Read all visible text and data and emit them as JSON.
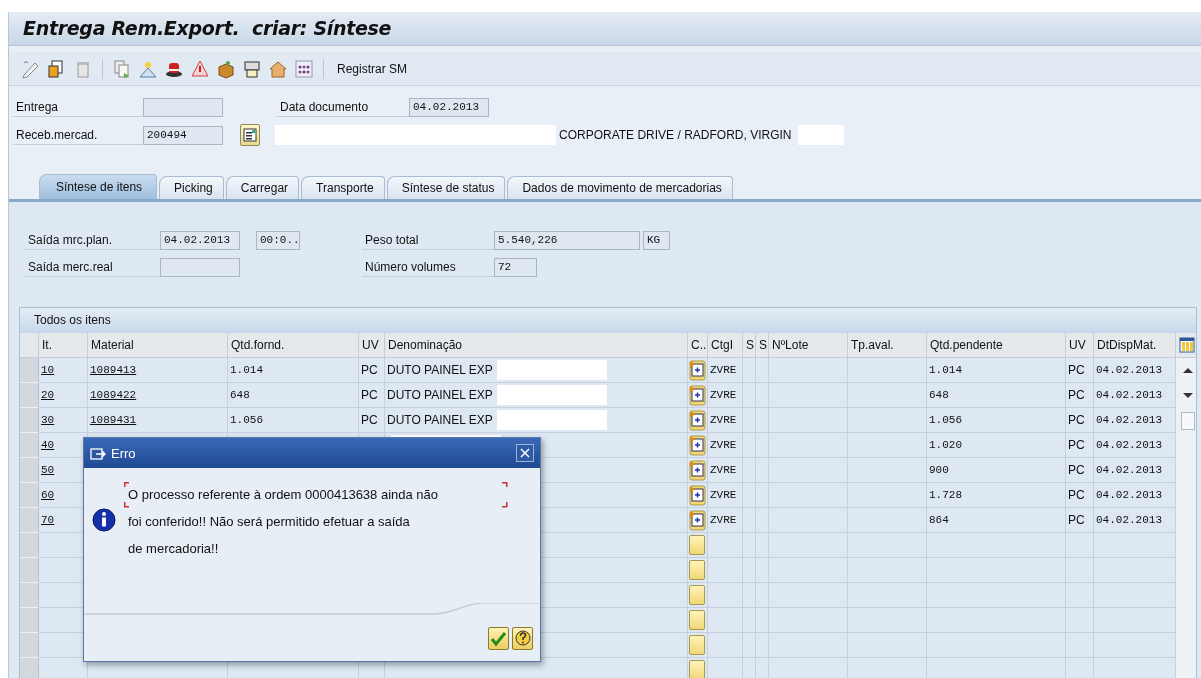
{
  "window": {
    "title": "Entrega Rem.Export.  criar: Síntese"
  },
  "toolbar": {
    "button_label": "Registrar SM"
  },
  "header": {
    "delivery": {
      "label": "Entrega"
    },
    "document_date": {
      "label": "Data documento",
      "value": "04.02.2013"
    },
    "ship_to": {
      "label": "Receb.mercad.",
      "value": "200494"
    },
    "address": "CORPORATE DRIVE / RADFORD, VIRGIN"
  },
  "tabs": [
    {
      "label": "Síntese de itens",
      "selected": true
    },
    {
      "label": "Picking",
      "selected": false
    },
    {
      "label": "Carregar",
      "selected": false
    },
    {
      "label": "Transporte",
      "selected": false
    },
    {
      "label": "Síntese de status",
      "selected": false
    },
    {
      "label": "Dados de movimento de mercadorias",
      "selected": false
    }
  ],
  "overview": {
    "planned_gi": {
      "label": "Saída mrc.plan.",
      "date": "04.02.2013",
      "time": "00:0.."
    },
    "actual_gi": {
      "label": "Saída merc.real"
    },
    "total_weight": {
      "label": "Peso total",
      "value": "5.540,226",
      "unit": "KG"
    },
    "packages": {
      "label": "Número volumes",
      "value": "72"
    }
  },
  "table": {
    "title": "Todos os itens",
    "columns": [
      "It.",
      "Material",
      "Qtd.fornd.",
      "UV",
      "Denominação",
      "C..",
      "CtgI",
      "S",
      "S",
      "NºLote",
      "Tp.aval.",
      "Qtd.pendente",
      "UV",
      "DtDispMat."
    ],
    "rows": [
      {
        "item": "10",
        "material": "1089413",
        "qty": "1.014",
        "uv": "PC",
        "description": "DUTO PAINEL EXP",
        "category": "ZVRE",
        "pending_qty": "1.014",
        "pending_uv": "PC",
        "date": "04.02.2013"
      },
      {
        "item": "20",
        "material": "1089422",
        "qty": "648",
        "uv": "PC",
        "description": "DUTO PAINEL EXP",
        "category": "ZVRE",
        "pending_qty": "648",
        "pending_uv": "PC",
        "date": "04.02.2013"
      },
      {
        "item": "30",
        "material": "1089431",
        "qty": "1.056",
        "uv": "PC",
        "description": "DUTO PAINEL EXP",
        "category": "ZVRE",
        "pending_qty": "1.056",
        "pending_uv": "PC",
        "date": "04.02.2013"
      },
      {
        "item": "40",
        "category": "ZVRE",
        "pending_qty": "1.020",
        "pending_uv": "PC",
        "date": "04.02.2013"
      },
      {
        "item": "50",
        "category": "ZVRE",
        "pending_qty": "900",
        "pending_uv": "PC",
        "date": "04.02.2013"
      },
      {
        "item": "60",
        "category": "ZVRE",
        "pending_qty": "1.728",
        "pending_uv": "PC",
        "date": "04.02.2013"
      },
      {
        "item": "70",
        "category": "ZVRE",
        "pending_qty": "864",
        "pending_uv": "PC",
        "date": "04.02.2013"
      }
    ]
  },
  "dialog": {
    "title": "Erro",
    "message": "O processo referente à ordem 0000413638 ainda não\nfoi conferido!! Não será permitido efetuar a saída\nde mercadoria!!"
  }
}
